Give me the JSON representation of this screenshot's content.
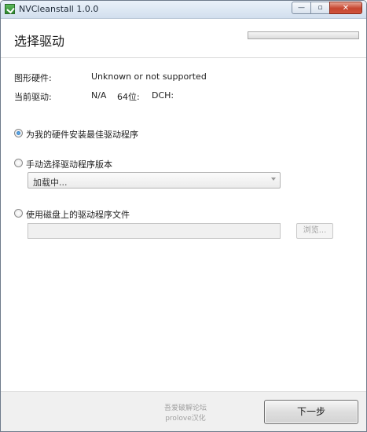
{
  "window": {
    "title": "NVCleanstall 1.0.0",
    "minimize_glyph": "—",
    "maximize_glyph": "▫",
    "close_glyph": "✕"
  },
  "header": {
    "title": "选择驱动",
    "progress_percent": 0
  },
  "info": {
    "gpu_label": "图形硬件:",
    "gpu_value": "Unknown or not supported",
    "driver_label": "当前驱动:",
    "driver_version": "N/A",
    "arch": "64位:",
    "dch": "DCH:"
  },
  "options": {
    "best_driver": "为我的硬件安装最佳驱动程序",
    "manual_version": "手动选择驱动程序版本",
    "version_combo_value": "加载中...",
    "from_disk": "使用磁盘上的驱动程序文件",
    "browse_label": "浏览...",
    "selected": "best_driver"
  },
  "footer": {
    "credit_line1": "吾爱破解论坛",
    "credit_line2": "prolove汉化",
    "next_label": "下一步"
  },
  "colors": {
    "close_button": "#c6452f",
    "radio_dot": "#1e64b0"
  }
}
